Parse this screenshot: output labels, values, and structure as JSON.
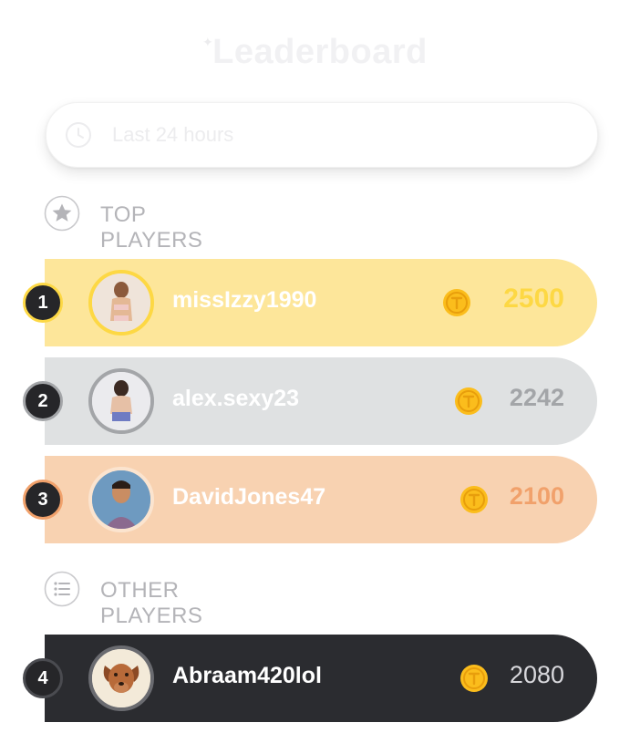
{
  "header": {
    "title": "Leaderboard"
  },
  "filter": {
    "label": "Last 24 hours",
    "icon": "clock-icon"
  },
  "sections": {
    "top": {
      "label": "TOP PLAYERS",
      "icon": "star-icon"
    },
    "other": {
      "label": "OTHER PLAYERS",
      "icon": "list-icon"
    }
  },
  "players": [
    {
      "rank": "1",
      "username": "missIzzy1990",
      "score": "2500",
      "tier": "gold"
    },
    {
      "rank": "2",
      "username": "alex.sexy23",
      "score": "2242",
      "tier": "silver"
    },
    {
      "rank": "3",
      "username": "DavidJones47",
      "score": "2100",
      "tier": "bronze"
    },
    {
      "rank": "4",
      "username": "Abraam420lol",
      "score": "2080",
      "tier": "default"
    }
  ],
  "colors": {
    "gold_bg": "#fde69a",
    "gold_accent": "#fdd844",
    "silver_bg": "#dfe1e2",
    "silver_accent": "#a3a5a8",
    "bronze_bg": "#f8d2b1",
    "bronze_accent": "#f1a16b",
    "default_bg": "#2b2c30",
    "coin": "#fbbd1c"
  }
}
